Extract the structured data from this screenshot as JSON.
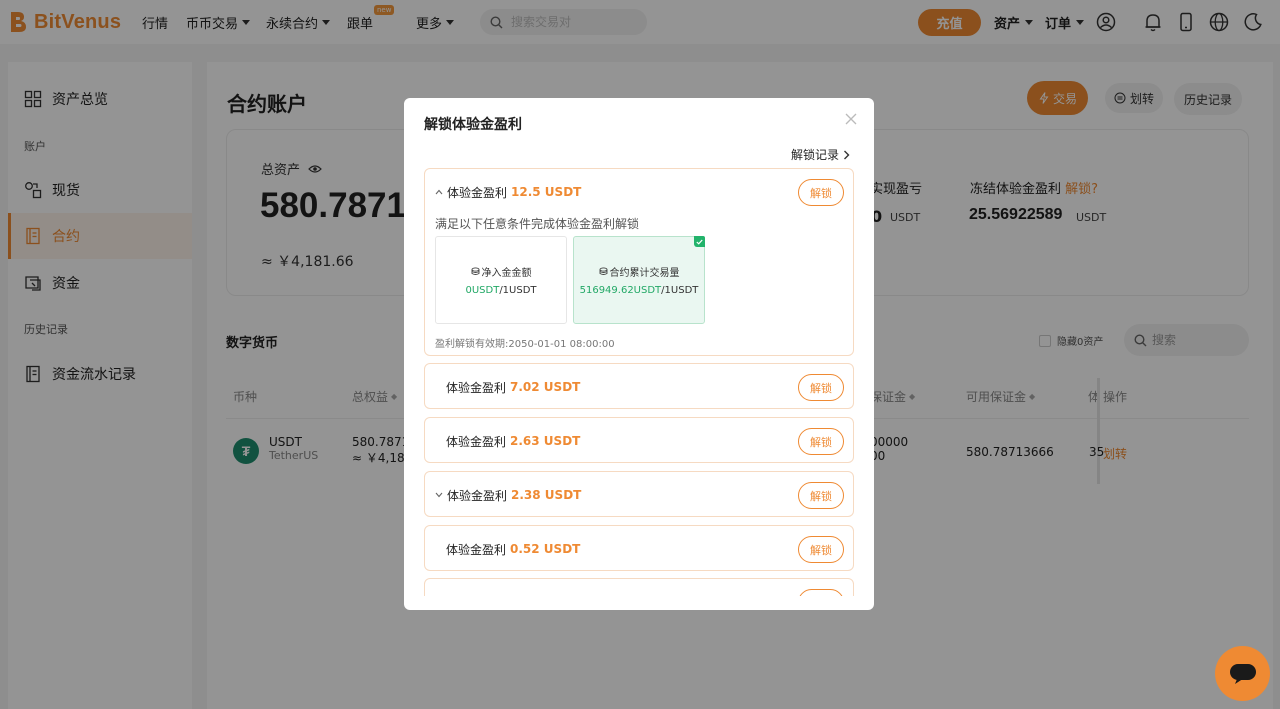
{
  "brand": {
    "name": "BitVenus",
    "accent": "#ef8a33"
  },
  "nav": {
    "items": [
      "行情",
      "币币交易",
      "永续合约",
      "跟单",
      "更多"
    ],
    "new_badge": "new",
    "search_placeholder": "搜索交易对",
    "deposit_label": "充值",
    "assets_label": "资产",
    "orders_label": "订单"
  },
  "sidebar": {
    "overview": "资产总览",
    "group_account": "账户",
    "spot": "现货",
    "contract": "合约",
    "funds": "资金",
    "group_history": "历史记录",
    "flow": "资金流水记录"
  },
  "main": {
    "title": "合约账户",
    "trade_label": "交易",
    "transfer_label": "划转",
    "history_label": "历史记录",
    "total_label": "总资产",
    "total_value": "580.7871",
    "total_cny": "≈ ￥4,181.66",
    "unreal_label": "实现盈亏",
    "unreal_value": "0",
    "unreal_unit": "USDT",
    "frozen_label": "冻结体验金盈利",
    "frozen_link": "解锁?",
    "frozen_value": "25.56922589",
    "frozen_unit": "USDT",
    "section_title": "数字货币",
    "hide_zero": "隐藏0资产",
    "search_placeholder": "搜索"
  },
  "table": {
    "headers": [
      "币种",
      "总权益",
      "保证金",
      "可用保证金",
      "体",
      "操作"
    ],
    "row": {
      "coin": "USDT",
      "coin_full": "TetherUS",
      "equity": "580.78713",
      "equity_cny": "≈ ￥4,181",
      "margin_1": "00000",
      "margin_2": "00",
      "available": "580.78713666",
      "exp_partial": "35",
      "op": "划转"
    }
  },
  "modal": {
    "title": "解锁体验金盈利",
    "log_link": "解锁记录",
    "reward_label": "体验金盈利",
    "unlock_label": "解锁",
    "condition_text": "满足以下任意条件完成体验金盈利解锁",
    "expiry": "盈利解锁有效期:2050-01-01 08:00:00",
    "conditions": [
      {
        "label": "净入金金额",
        "current": "0USDT",
        "target": "/1USDT",
        "met": false
      },
      {
        "label": "合约累计交易量",
        "current": "516949.62USDT",
        "target": "/1USDT",
        "met": true
      }
    ],
    "rewards": [
      {
        "amount": "12.5 USDT",
        "expanded": true
      },
      {
        "amount": "7.02 USDT",
        "expanded": false
      },
      {
        "amount": "2.63 USDT",
        "expanded": false
      },
      {
        "amount": "2.38 USDT",
        "expanded": false
      },
      {
        "amount": "0.52 USDT",
        "expanded": false
      }
    ]
  }
}
